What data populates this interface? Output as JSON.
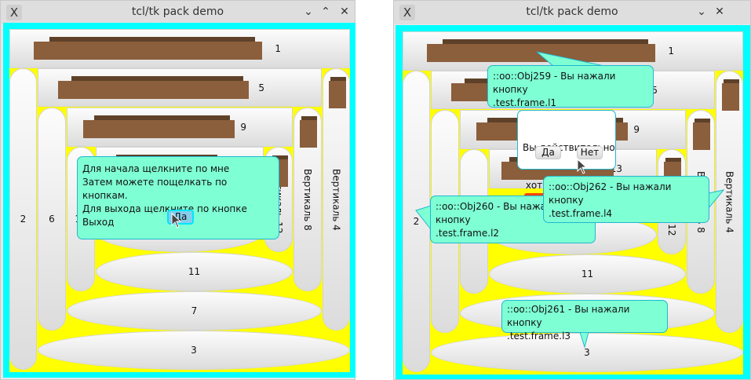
{
  "windows": [
    {
      "title": "tcl/tk pack demo",
      "controls": [
        "minimize",
        "maximize",
        "close"
      ],
      "tooltip": {
        "lines": [
          "Для начала щелкните по мне",
          "Затем можете пощелкать по кнопкам.",
          "Для выхода щелкните по кнопке Выход"
        ],
        "button": "Да"
      }
    },
    {
      "title": "tcl/tk pack demo",
      "controls": [
        "minimize",
        "close"
      ],
      "dialog": {
        "lines": [
          "Вы действительно",
          " хотите выйти?"
        ],
        "yes": "Да",
        "no": "Нет"
      },
      "balloons": [
        {
          "lines": [
            "::oo::Obj259 - Вы нажали кнопку",
            ".test.frame.l1"
          ]
        },
        {
          "lines": [
            "::oo::Obj260 - Вы нажали кнопку",
            ".test.frame.l2"
          ]
        },
        {
          "lines": [
            "::oo::Obj262 - Вы нажали кнопку",
            ".test.frame.l4"
          ]
        },
        {
          "lines": [
            "::oo::Obj261 - Вы нажали кнопку",
            ".test.frame.l3"
          ]
        }
      ]
    }
  ],
  "widgets": {
    "l1": "1",
    "l2": "2",
    "l3": "3",
    "l4": "Вертикаль 4",
    "l5": "5",
    "l6": "6",
    "l7": "7",
    "l8": "Вертикаль 8",
    "l9": "9",
    "l10": "10",
    "l11": "11",
    "l12": "Вертикаль 12",
    "l13": "13"
  },
  "colors": {
    "border": "#00ffff",
    "background": "#ffff00",
    "balloon": "#7fffd4",
    "image": "#8b5e3c"
  }
}
